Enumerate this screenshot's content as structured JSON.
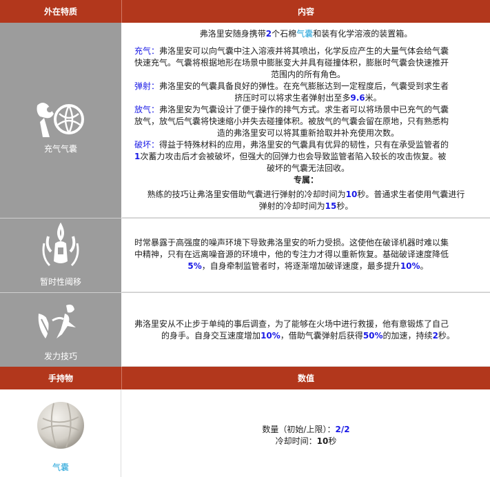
{
  "header1": {
    "col1": "外在特质",
    "col2": "内容"
  },
  "trait1": {
    "label": "充气气囊",
    "intro": {
      "pre": "弗洛里安随身携带",
      "num": "2",
      "mid": "个石棉",
      "link": "气囊",
      "post": "和装有化学溶液的装置箱。"
    },
    "p1": {
      "key": "充气：",
      "line1": "弗洛里安可以向气囊中注入溶液并将其喷出，化学反应产生的大量气体会给气囊",
      "line2": "快速充气。气囊将根据地形在场景中膨胀变大并具有碰撞体积，膨胀时气囊会快速推开",
      "line3": "范围内的所有角色。"
    },
    "p2": {
      "key": "弹射：",
      "line1": "弗洛里安的气囊具备良好的弹性。在充气膨胀达到一定程度后，气囊受到求生者",
      "line2pre": "挤压时可以将求生者弹射出至多",
      "num": "9.6",
      "line2post": "米。"
    },
    "p3": {
      "key": "放气：",
      "line1": "弗洛里安为气囊设计了便于操作的排气方式。求生者可以将场景中已充气的气囊",
      "line2": "放气，放气后气囊将快速缩小并失去碰撞体积。被放气的气囊会留在原地，只有熟悉构",
      "line3": "造的弗洛里安可以将其重新拾取并补充使用次数。"
    },
    "p4": {
      "key": "破坏：",
      "line1": "得益于特殊材料的应用，弗洛里安的气囊具有优异的韧性，只有在承受监管者的",
      "num": "1",
      "line2post": "次蓄力攻击后才会被破坏，但强大的回弹力也会导致监管者陷入较长的攻击恢复。被",
      "line3": "破坏的气囊无法回收。"
    },
    "special_title": "专属：",
    "special": {
      "pre": "熟练的技巧让弗洛里安借助气囊进行弹射的冷却时间为",
      "num1": "10",
      "mid": "秒。普通求生者使用气囊进行",
      "line2pre": "弹射的冷却时间为",
      "num2": "15",
      "post": "秒。"
    }
  },
  "trait2": {
    "label": "暂时性阈移",
    "line1": "时常暴露于高强度的噪声环境下导致弗洛里安的听力受损。这使他在破译机器时难以集",
    "line2": "中精神，只有在远离噪音源的环境中，他的专注力才得以重新恢复。基础破译速度降低",
    "num1": "5%",
    "mid": "，自身牵制监管者时，将逐渐增加破译速度，最多提升",
    "num2": "10%",
    "post": "。"
  },
  "trait3": {
    "label": "发力技巧",
    "line1": "弗洛里安从不止步于单纯的事后调查，为了能够在火场中进行救援，他有意锻炼了自己",
    "pre": "的身手。自身交互速度增加",
    "num1": "10%",
    "mid": "，借助气囊弹射后获得",
    "num2": "50%",
    "mid2": "的加速，持续",
    "num3": "2",
    "post": "秒。"
  },
  "header2": {
    "col1": "手持物",
    "col2": "数值"
  },
  "item": {
    "label": "气囊",
    "qty_label": "数量（初始/上限）：",
    "qty_value": "2/2",
    "cd_label": "冷却时间：",
    "cd_value": "10",
    "cd_unit": "秒"
  },
  "colors": {
    "header_bg": "#b2371c",
    "left_bg": "#9c9c9c",
    "highlight_blue": "#1a1ae6",
    "link_cyan": "#1aa0d8"
  }
}
